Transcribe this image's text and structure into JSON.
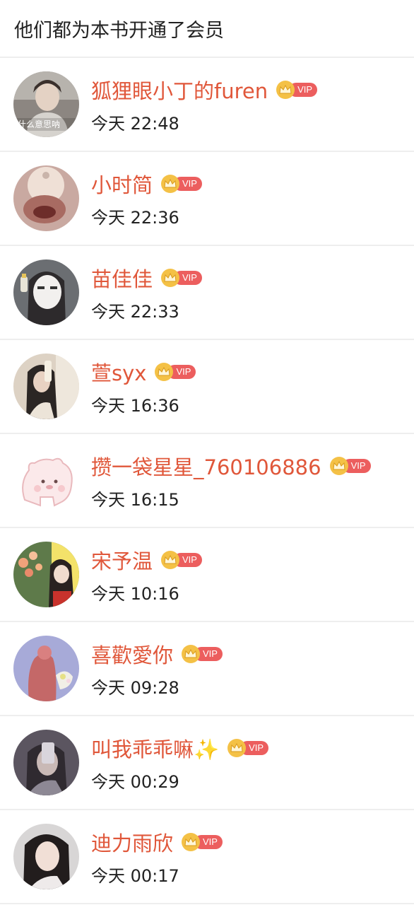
{
  "header": {
    "title": "他们都为本书开通了会员"
  },
  "vip_label": "VIP",
  "colors": {
    "name": "#e0573a",
    "vip_pill": "#ec5e5e",
    "crown": "#f4c146"
  },
  "members": [
    {
      "name": "狐狸眼小丁的furen",
      "time": "今天 22:48",
      "avatar_caption": "什么意思呐"
    },
    {
      "name": "小时简",
      "time": "今天 22:36"
    },
    {
      "name": "苗佳佳",
      "time": "今天 22:33"
    },
    {
      "name": "萱syx",
      "time": "今天 16:36"
    },
    {
      "name": "攒一袋星星_760106886",
      "time": "今天 16:15"
    },
    {
      "name": "宋予温",
      "time": "今天 10:16"
    },
    {
      "name": "喜歡愛你",
      "time": "今天 09:28"
    },
    {
      "name": "叫我乖乖嘛✨",
      "time": "今天 00:29"
    },
    {
      "name": "迪力雨欣",
      "time": "今天 00:17"
    }
  ]
}
